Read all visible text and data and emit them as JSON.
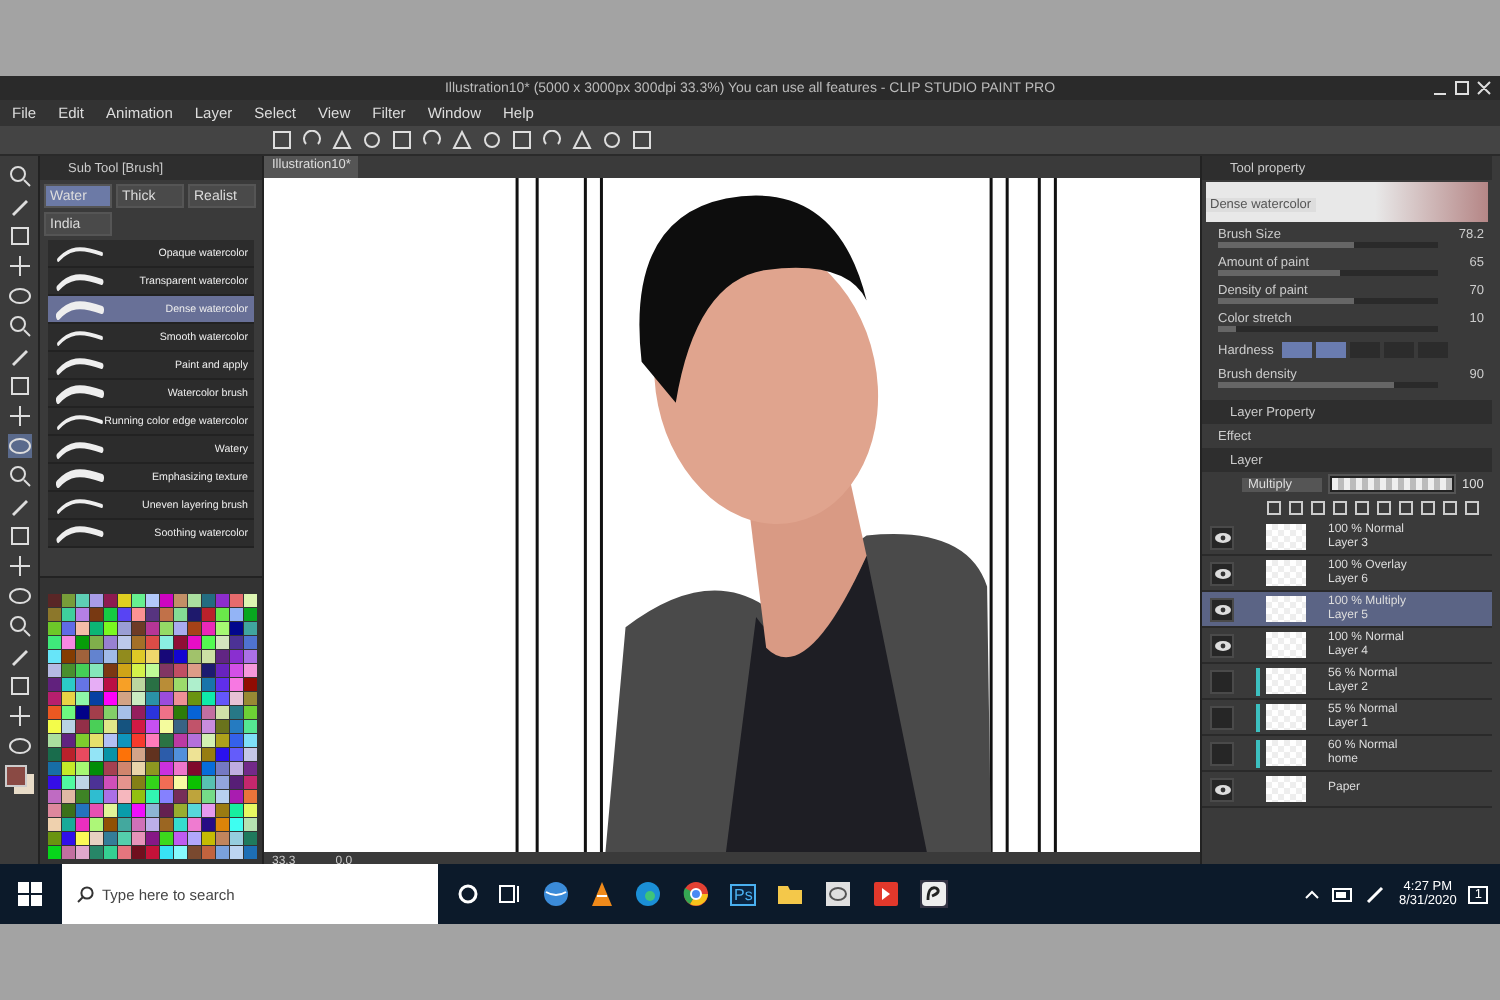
{
  "window": {
    "title": "Illustration10* (5000 x 3000px 300dpi 33.3%)  You can use all features - CLIP STUDIO PAINT PRO"
  },
  "menu": [
    "File",
    "Edit",
    "Animation",
    "Layer",
    "Select",
    "View",
    "Filter",
    "Window",
    "Help"
  ],
  "sub_tool": {
    "title": "Sub Tool [Brush]",
    "tabs": [
      {
        "label": "Water",
        "selected": true
      },
      {
        "label": "Thick",
        "selected": false
      },
      {
        "label": "Realist",
        "selected": false
      },
      {
        "label": "India",
        "selected": false
      }
    ],
    "brushes": [
      {
        "name": "Opaque watercolor",
        "selected": false
      },
      {
        "name": "Transparent watercolor",
        "selected": false
      },
      {
        "name": "Dense watercolor",
        "selected": true
      },
      {
        "name": "Smooth watercolor",
        "selected": false
      },
      {
        "name": "Paint and apply",
        "selected": false
      },
      {
        "name": "Watercolor brush",
        "selected": false
      },
      {
        "name": "Running color edge watercolor",
        "selected": false
      },
      {
        "name": "Watery",
        "selected": false
      },
      {
        "name": "Emphasizing texture",
        "selected": false
      },
      {
        "name": "Uneven layering brush",
        "selected": false
      },
      {
        "name": "Soothing watercolor",
        "selected": false
      }
    ]
  },
  "canvas": {
    "tab": "Illustration10*",
    "zoom": "33.3",
    "angle": "0.0"
  },
  "tool_property": {
    "title": "Tool property",
    "preset": "Dense watercolor",
    "properties": [
      {
        "kind": "slider",
        "label": "Brush Size",
        "value": "78.2",
        "level": 0.62
      },
      {
        "kind": "slider",
        "label": "Amount of paint",
        "value": "65",
        "level": 0.55
      },
      {
        "kind": "slider",
        "label": "Density of paint",
        "value": "70",
        "level": 0.62
      },
      {
        "kind": "slider",
        "label": "Color stretch",
        "value": "10",
        "level": 0.08
      },
      {
        "kind": "steps",
        "label": "Hardness",
        "level": 0.4
      },
      {
        "kind": "slider",
        "label": "Brush density",
        "value": "90",
        "level": 0.8
      }
    ]
  },
  "layer_property": {
    "title": "Layer Property",
    "effect": "Effect"
  },
  "layer_panel": {
    "title": "Layer",
    "blend": "Multiply",
    "opacity": "100",
    "opacity_slider": {
      "level": 1
    },
    "layers": [
      {
        "mode": "100 % Normal",
        "name": "Layer 3",
        "visible": true,
        "selected": false,
        "clipped": false
      },
      {
        "mode": "100 % Overlay",
        "name": "Layer 6",
        "visible": true,
        "selected": false,
        "clipped": false
      },
      {
        "mode": "100 % Multiply",
        "name": "Layer 5",
        "visible": true,
        "selected": true,
        "clipped": false
      },
      {
        "mode": "100 % Normal",
        "name": "Layer 4",
        "visible": true,
        "selected": false,
        "clipped": false
      },
      {
        "mode": "56 % Normal",
        "name": "Layer 2",
        "visible": false,
        "selected": false,
        "clipped": true
      },
      {
        "mode": "55 % Normal",
        "name": "Layer 1",
        "visible": false,
        "selected": false,
        "clipped": true
      },
      {
        "mode": "60 % Normal",
        "name": "home",
        "visible": false,
        "selected": false,
        "clipped": true
      },
      {
        "name": "Paper",
        "visible": true,
        "selected": false,
        "clipped": false
      }
    ]
  },
  "taskbar": {
    "search_placeholder": "Type here to search",
    "ps_label": "Ps",
    "time": "4:27 PM",
    "date": "8/31/2020",
    "notifications": "1"
  }
}
